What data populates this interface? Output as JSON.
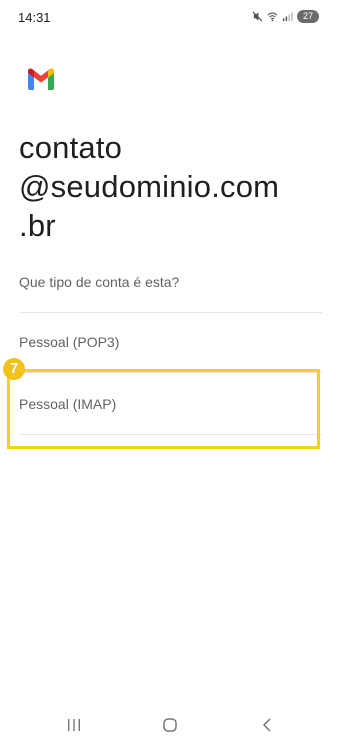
{
  "status_bar": {
    "time": "14:31",
    "battery": "27",
    "icons": [
      "mute-icon",
      "wifi-icon",
      "signal-icon",
      "battery-icon"
    ]
  },
  "app": {
    "logo": "gmail-logo-icon"
  },
  "account": {
    "email_lines": [
      "contato",
      "@seudominio.com",
      ".br"
    ]
  },
  "account_type": {
    "prompt": "Que tipo de conta é esta?",
    "options": [
      "Pessoal (POP3)",
      "Pessoal (IMAP)"
    ]
  },
  "annotation": {
    "step": "7",
    "color": "#f2d21b"
  },
  "nav_bar": {
    "icons": [
      "recent-apps-icon",
      "home-icon",
      "back-icon"
    ]
  }
}
